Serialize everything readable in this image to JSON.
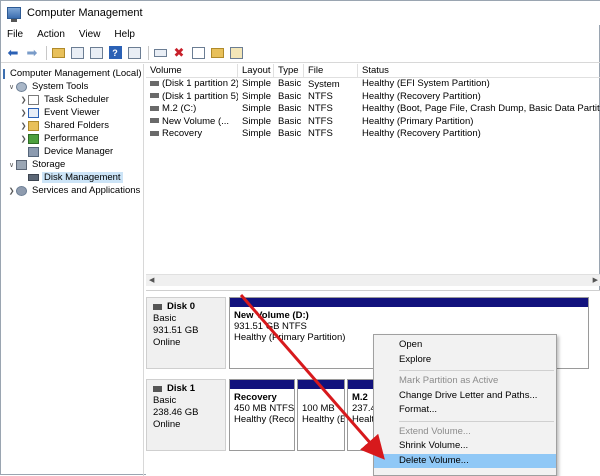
{
  "window": {
    "title": "Computer Management"
  },
  "menubar": {
    "items": [
      "File",
      "Action",
      "View",
      "Help"
    ]
  },
  "toolbar": {
    "buttons": [
      "back-arrow-icon",
      "forward-arrow-icon",
      "up-folder-icon",
      "show-hide-tree-icon",
      "help-icon",
      "properties-icon",
      "connect-icon",
      "delete-icon",
      "check-icon",
      "folder-icon",
      "export-icon"
    ]
  },
  "tree": {
    "items": [
      {
        "label": "Computer Management (Local)",
        "depth": 0,
        "expander": "",
        "icon": "computer-icon"
      },
      {
        "label": "System Tools",
        "depth": 1,
        "expander": "v",
        "icon": "tools-icon"
      },
      {
        "label": "Task Scheduler",
        "depth": 2,
        "expander": ">",
        "icon": "calendar-icon"
      },
      {
        "label": "Event Viewer",
        "depth": 2,
        "expander": ">",
        "icon": "event-viewer-icon"
      },
      {
        "label": "Shared Folders",
        "depth": 2,
        "expander": ">",
        "icon": "shared-folder-icon"
      },
      {
        "label": "Performance",
        "depth": 2,
        "expander": ">",
        "icon": "performance-icon"
      },
      {
        "label": "Device Manager",
        "depth": 2,
        "expander": "",
        "icon": "device-manager-icon"
      },
      {
        "label": "Storage",
        "depth": 1,
        "expander": "v",
        "icon": "storage-icon"
      },
      {
        "label": "Disk Management",
        "depth": 2,
        "expander": "",
        "icon": "disk-icon",
        "selected": true
      },
      {
        "label": "Services and Applications",
        "depth": 1,
        "expander": ">",
        "icon": "services-icon"
      }
    ]
  },
  "volumes": {
    "headers": [
      "Volume",
      "Layout",
      "Type",
      "File System",
      "Status"
    ],
    "rows": [
      [
        "(Disk 1 partition 2)",
        "Simple",
        "Basic",
        "",
        "Healthy (EFI System Partition)"
      ],
      [
        "(Disk 1 partition 5)",
        "Simple",
        "Basic",
        "NTFS",
        "Healthy (Recovery Partition)"
      ],
      [
        "M.2 (C:)",
        "Simple",
        "Basic",
        "NTFS",
        "Healthy (Boot, Page File, Crash Dump, Basic Data Partition)"
      ],
      [
        "New Volume (...",
        "Simple",
        "Basic",
        "NTFS",
        "Healthy (Primary Partition)"
      ],
      [
        "Recovery",
        "Simple",
        "Basic",
        "NTFS",
        "Healthy (Recovery Partition)"
      ]
    ]
  },
  "disks": [
    {
      "name": "Disk 0",
      "type": "Basic",
      "size": "931.51 GB",
      "state": "Online",
      "partitions": [
        {
          "name": "New Volume  (D:)",
          "line2": "931.51 GB NTFS",
          "line3": "Healthy (Primary Partition)"
        }
      ]
    },
    {
      "name": "Disk 1",
      "type": "Basic",
      "size": "238.46 GB",
      "state": "Online",
      "partitions": [
        {
          "name": "Recovery",
          "line2": "450 MB NTFS",
          "line3": "Healthy (Reco"
        },
        {
          "name": "",
          "line2": "100 MB",
          "line3": "Healthy (E"
        },
        {
          "name": "M.2",
          "line2": "237.4",
          "line3": "Healt"
        }
      ]
    }
  ],
  "context_menu": {
    "items": [
      {
        "label": "Open",
        "enabled": true
      },
      {
        "label": "Explore",
        "enabled": true
      },
      {
        "separator": true
      },
      {
        "label": "Mark Partition as Active",
        "enabled": false
      },
      {
        "label": "Change Drive Letter and Paths...",
        "enabled": true
      },
      {
        "label": "Format...",
        "enabled": true
      },
      {
        "separator": true
      },
      {
        "label": "Extend Volume...",
        "enabled": false
      },
      {
        "label": "Shrink Volume...",
        "enabled": true
      },
      {
        "label": "Delete Volume...",
        "enabled": true,
        "highlighted": true
      }
    ]
  },
  "colors": {
    "partition_bar": "#12127d",
    "highlight": "#90c8f6",
    "annotation_arrow": "#d7191c",
    "selection": "#cce4f7"
  }
}
